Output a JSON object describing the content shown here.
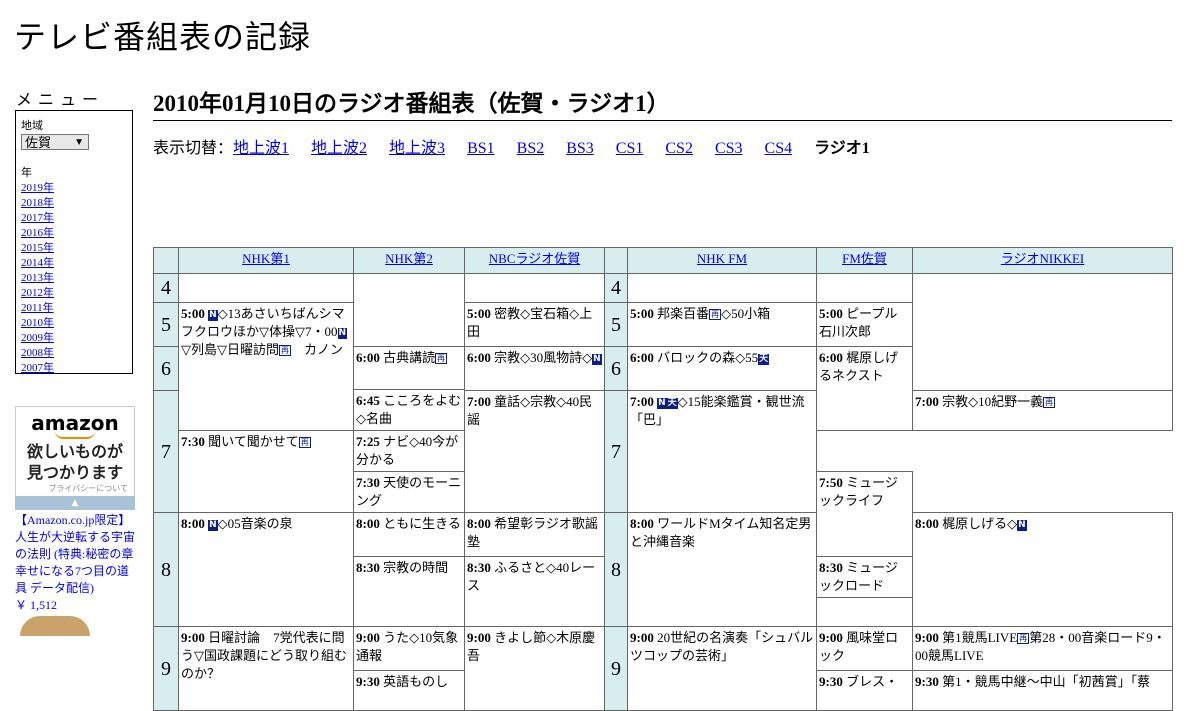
{
  "site_title": "テレビ番組表の記録",
  "menu": {
    "heading": "メニュー",
    "region_label": "地域",
    "region_value": "佐賀",
    "year_label": "年",
    "years": [
      "2019年",
      "2018年",
      "2017年",
      "2016年",
      "2015年",
      "2014年",
      "2013年",
      "2012年",
      "2011年",
      "2010年",
      "2009年",
      "2008年",
      "2007年"
    ]
  },
  "ad": {
    "logo": "amazon",
    "message_line1": "欲しいものが",
    "message_line2": "見つかります",
    "privacy": "プライバシーについて",
    "book_title": "【Amazon.co.jp限定】人生が大逆転する宇宙の法則 (特典:秘密の章 幸せになる7つ目の道具 データ配信)",
    "book_price": "￥ 1,512"
  },
  "page_heading": "2010年01月10日のラジオ番組表（佐賀・ラジオ1）",
  "switcher": {
    "label": "表示切替：",
    "links": [
      "地上波1",
      "地上波2",
      "地上波3",
      "BS1",
      "BS2",
      "BS3",
      "CS1",
      "CS2",
      "CS3",
      "CS4"
    ],
    "current": "ラジオ1"
  },
  "channels": [
    "NHK第1",
    "NHK第2",
    "NBCラジオ佐賀",
    "NHK FM",
    "FM佐賀",
    "ラジオNIKKEI"
  ],
  "hours": [
    "4",
    "5",
    "6",
    "7",
    "8",
    "9"
  ],
  "programs": {
    "nhk1_500_time": "5:00",
    "nhk1_500_a": "◇13あさいちばんシマフクロウほか▽体操▽7・00",
    "nhk1_500_b": "▽列島▽日曜訪問",
    "nhk1_500_c": "　カノン",
    "nhk1_800_time": "8:00",
    "nhk1_800_a": "◇05音楽の泉",
    "nhk1_900_time": "9:00",
    "nhk1_900_a": "日曜討論　7党代表に問う▽国政課題にどう取り組むのか？",
    "nhk2_600_time": "6:00",
    "nhk2_600_a": "古典講読",
    "nhk2_645_time": "6:45",
    "nhk2_645_a": "こころをよむ◇名曲",
    "nhk2_730_time": "7:30",
    "nhk2_730_a": "聞いて聞かせて",
    "nhk2_800_time": "8:00",
    "nhk2_800_a": "ともに生きる",
    "nhk2_830_time": "8:30",
    "nhk2_830_a": "宗教の時間",
    "nhk2_900_time": "9:00",
    "nhk2_900_a": "うた◇10気象通報",
    "nhk2_930_time": "9:30",
    "nhk2_930_a": "英語ものし",
    "nbc_500_time": "5:00",
    "nbc_500_a": "密教◇宝石箱◇上田",
    "nbc_600_time": "6:00",
    "nbc_600_a": "宗教◇30風物詩◇",
    "nbc_700_time": "7:00",
    "nbc_700_a": "童話◇宗教◇40民謡",
    "nbc_800_time": "8:00",
    "nbc_800_a": "希望彰ラジオ歌謡塾",
    "nbc_830_time": "8:30",
    "nbc_830_a": "ふるさと◇40レース",
    "nbc_900_time": "9:00",
    "nbc_900_a": "きよし節◇木原慶吾",
    "fm_500_time": "5:00",
    "fm_500_a": "邦楽百番",
    "fm_500_b": "◇50小箱",
    "fm_600_time": "6:00",
    "fm_600_a": "バロックの森◇55",
    "fm_700_time": "7:00",
    "fm_700_a": "◇15能楽鑑賞・観世流「巴」",
    "fm_800_time": "8:00",
    "fm_800_a": "ワールドMタイム知名定男と沖縄音楽",
    "fm_900_time": "9:00",
    "fm_900_a": "20世紀の名演奏「シュバルツコップの芸術」",
    "fmsaga_500_time": "5:00",
    "fmsaga_500_a": "ピープル石川次郎",
    "fmsaga_600_time": "6:00",
    "fmsaga_600_a": "梶原しげるネクスト",
    "fmsaga_730_time": "7:30",
    "fmsaga_730_a": "天使のモーニング",
    "fmsaga_800_time": "8:00",
    "fmsaga_800_a": "梶原しげる◇",
    "fmsaga_900_time": "9:00",
    "fmsaga_900_a": "風味堂ロック",
    "fmsaga_930_time": "9:30",
    "fmsaga_930_a": "ブレス・",
    "nikkei_700_time": "7:00",
    "nikkei_700_a": "宗教◇10紀野一義",
    "nikkei_725_time": "7:25",
    "nikkei_725_a": "ナビ◇40今が分かる",
    "nikkei_750_time": "7:50",
    "nikkei_750_a": "ミュージックライフ",
    "nikkei_830_time": "8:30",
    "nikkei_830_a": "ミュージックロード",
    "nikkei_900_time": "9:00",
    "nikkei_900_a": "第1競馬LIVE",
    "nikkei_900_b": "第28・00音楽ロード9・00競馬LIVE",
    "nikkei_930_time": "9:30",
    "nikkei_930_a": "第1・競馬中継～中山「初茜賞」「蔡"
  },
  "badges": {
    "news": "N",
    "rerun": "再",
    "weather": "天"
  }
}
